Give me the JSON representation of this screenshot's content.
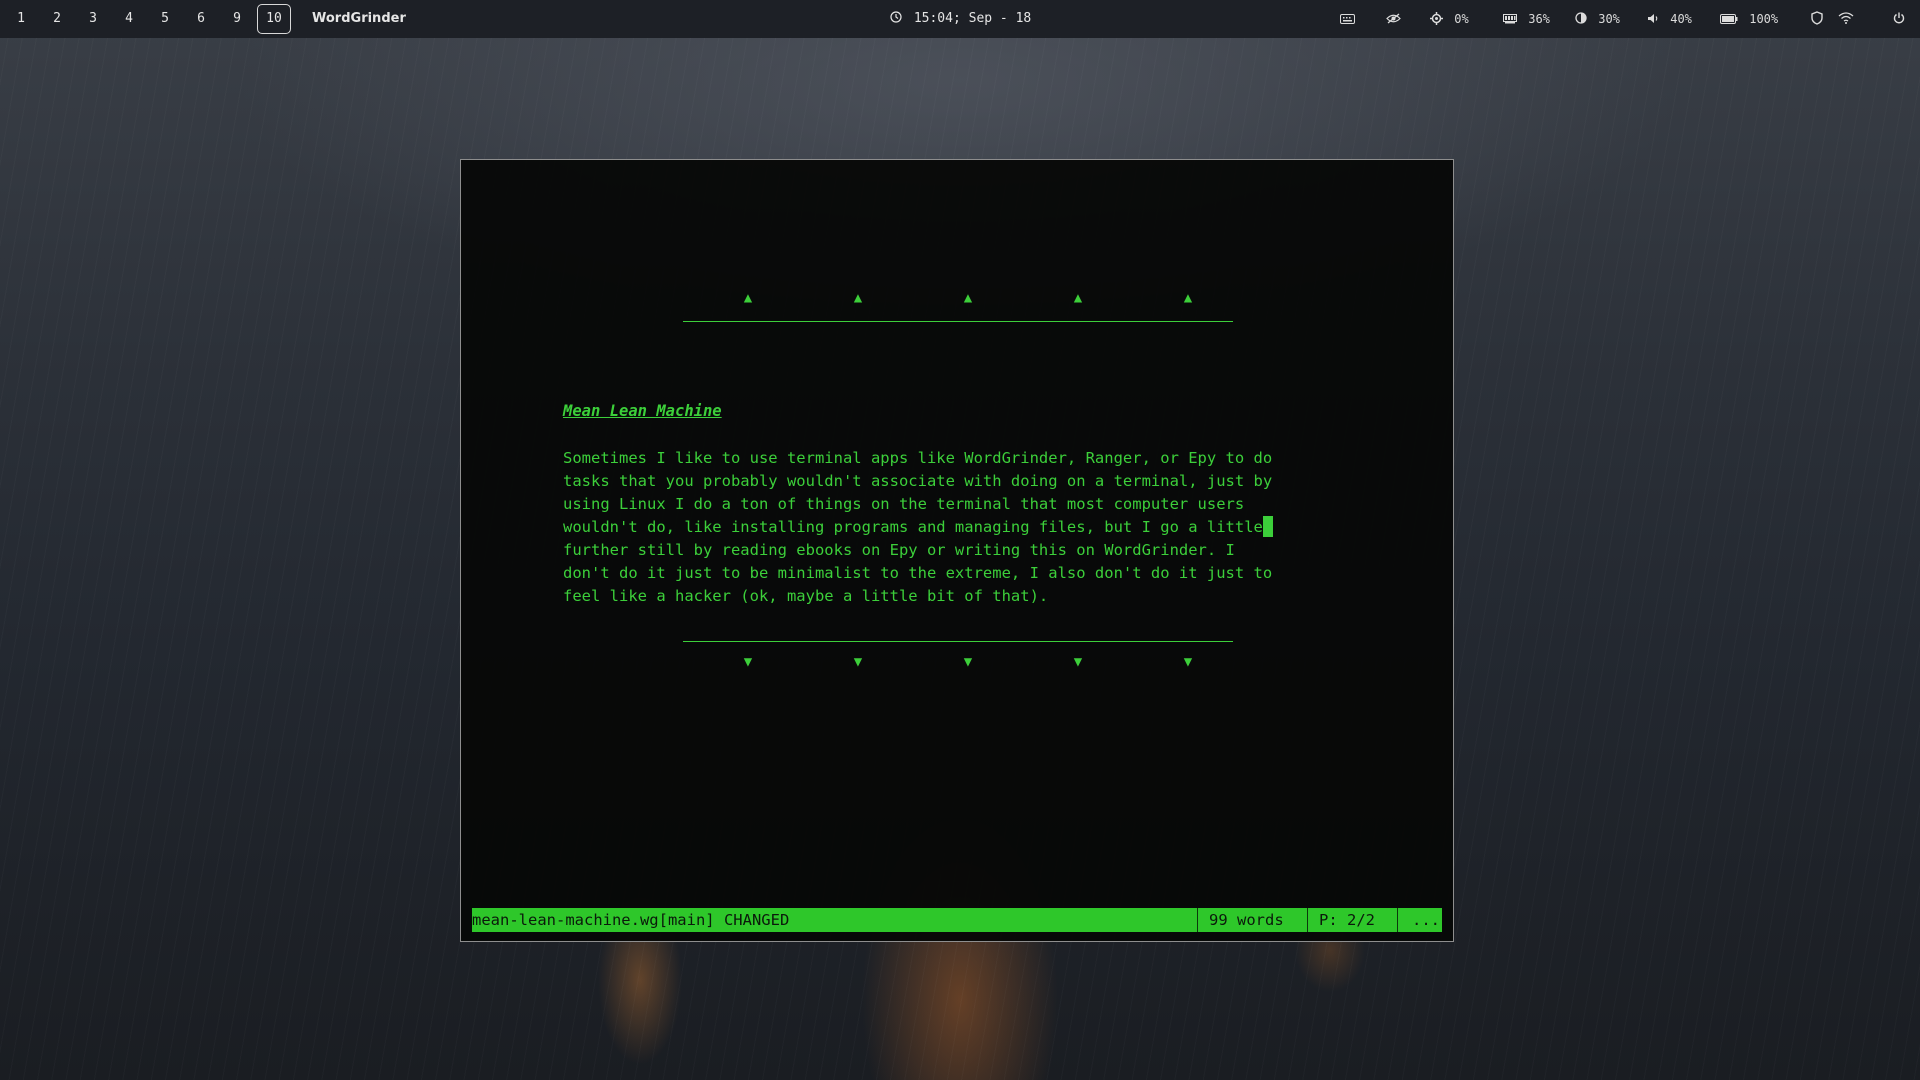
{
  "topbar": {
    "workspaces": [
      "1",
      "2",
      "3",
      "4",
      "5",
      "6",
      "9",
      "10"
    ],
    "active_workspace": "10",
    "window_title": "WordGrinder",
    "clock": "15:04; Sep - 18",
    "icons": {
      "clock": "clock-icon",
      "keyboard": "keyboard-icon",
      "eye": "eye-slash-icon",
      "cpu": "cpu-icon",
      "memory": "memory-icon",
      "brightness": "brightness-icon",
      "volume": "volume-icon",
      "battery": "battery-icon",
      "shield": "shield-icon",
      "wifi": "wifi-icon",
      "power": "power-icon"
    },
    "tray": {
      "cpu": "0%",
      "memory": "36%",
      "brightness": "30%",
      "volume": "40%",
      "battery": "100%"
    }
  },
  "editor": {
    "title": "Mean Lean Machine",
    "lines": [
      "Sometimes I like to use terminal apps like WordGrinder, Ranger, or Epy to do",
      "tasks that you probably wouldn't associate with doing on a terminal, just by",
      "using Linux I do a ton of things on the terminal that most computer users",
      "wouldn't do, like installing programs and managing files, but I go a little",
      "further still by reading ebooks on Epy or writing this on WordGrinder. I",
      "don't do it just to be minimalist to the extreme, I also don't do it just to",
      "feel like a hacker (ok, maybe a little bit of that)."
    ],
    "cursor_line": 3,
    "accent_color": "#3ccf3a"
  },
  "statusbar": {
    "file": "mean-lean-machine.wg[main] CHANGED",
    "words": "99 words",
    "page": "P: 2/2",
    "more": "..."
  }
}
